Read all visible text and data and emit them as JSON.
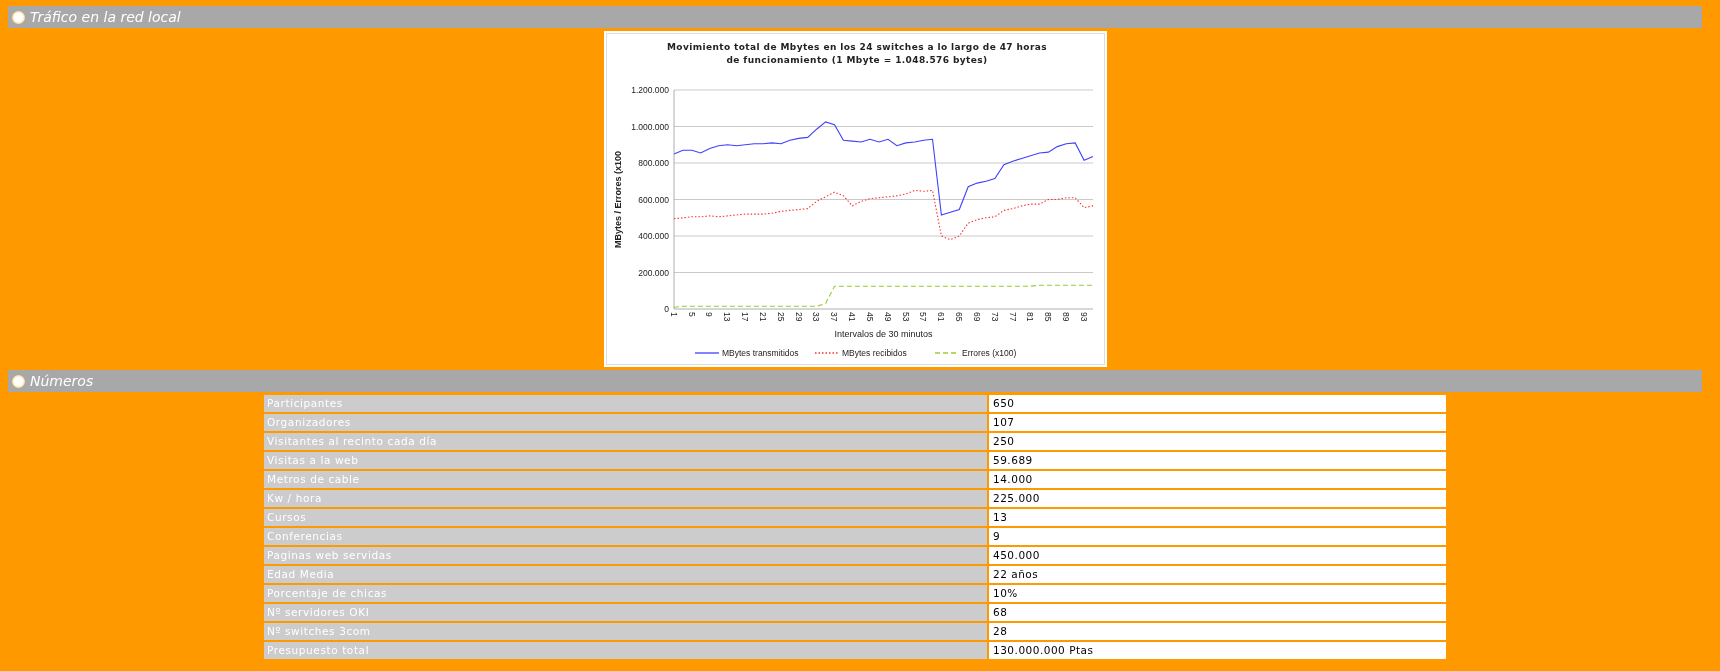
{
  "sections": [
    {
      "title": "Tráfico en la red local",
      "chart_data": {
        "type": "line",
        "title": "Movimiento total de Mbytes en los 24 switches a lo largo de 47 horas de funcionamiento (1 Mbyte = 1.048.576 bytes)",
        "xlabel": "Intervalos de 30 minutos",
        "ylabel": "MBytes / Errores (x100",
        "x": [
          1,
          3,
          5,
          7,
          9,
          11,
          13,
          15,
          17,
          19,
          21,
          23,
          25,
          27,
          29,
          31,
          33,
          35,
          37,
          39,
          41,
          43,
          45,
          47,
          49,
          51,
          53,
          55,
          57,
          59,
          61,
          63,
          65,
          67,
          69,
          71,
          73,
          75,
          77,
          79,
          81,
          83,
          85,
          87,
          89,
          91,
          93,
          95
        ],
        "series": [
          {
            "name": "MBytes transmitidos",
            "color": "#4040ff",
            "line_style": "solid",
            "values": [
              850000,
              870000,
              870000,
              855000,
              880000,
              895000,
              900000,
              895000,
              900000,
              905000,
              905000,
              910000,
              905000,
              925000,
              935000,
              940000,
              985000,
              1025000,
              1010000,
              925000,
              920000,
              915000,
              930000,
              915000,
              930000,
              895000,
              910000,
              915000,
              925000,
              930000,
              515000,
              530000,
              545000,
              670000,
              690000,
              700000,
              715000,
              790000,
              810000,
              825000,
              840000,
              855000,
              860000,
              890000,
              905000,
              910000,
              815000,
              835000
            ]
          },
          {
            "name": "MBytes recibidos",
            "color": "#ff3030",
            "line_style": "dotted",
            "values": [
              495000,
              500000,
              505000,
              505000,
              510000,
              505000,
              510000,
              515000,
              520000,
              520000,
              520000,
              525000,
              535000,
              540000,
              545000,
              550000,
              590000,
              615000,
              640000,
              620000,
              565000,
              590000,
              605000,
              610000,
              615000,
              620000,
              630000,
              650000,
              645000,
              650000,
              400000,
              380000,
              400000,
              470000,
              490000,
              500000,
              505000,
              540000,
              550000,
              565000,
              575000,
              575000,
              600000,
              600000,
              610000,
              610000,
              555000,
              565000
            ]
          },
          {
            "name": "Errores (x100)",
            "color": "#99cc33",
            "line_style": "dashed",
            "values": [
              10000,
              15000,
              15000,
              15000,
              15000,
              15000,
              15000,
              15000,
              15000,
              15000,
              15000,
              15000,
              15000,
              15000,
              15000,
              15000,
              15000,
              30000,
              125000,
              125000,
              125000,
              125000,
              125000,
              125000,
              125000,
              125000,
              125000,
              125000,
              125000,
              125000,
              125000,
              125000,
              125000,
              125000,
              125000,
              125000,
              125000,
              125000,
              125000,
              125000,
              125000,
              130000,
              130000,
              130000,
              130000,
              130000,
              130000,
              130000
            ]
          }
        ],
        "xlim": [
          1,
          95
        ],
        "ylim": [
          0,
          1200000
        ],
        "grid": true,
        "legend": "bottom",
        "xticks": [
          1,
          5,
          9,
          13,
          17,
          21,
          25,
          29,
          33,
          37,
          41,
          45,
          49,
          53,
          57,
          61,
          65,
          69,
          73,
          77,
          81,
          85,
          89,
          93
        ],
        "yticks": [
          {
            "value": 0,
            "label": "0"
          },
          {
            "value": 200000,
            "label": "200.000"
          },
          {
            "value": 400000,
            "label": "400.000"
          },
          {
            "value": 600000,
            "label": "600.000"
          },
          {
            "value": 800000,
            "label": "800.000"
          },
          {
            "value": 1000000,
            "label": "1.000.000"
          },
          {
            "value": 1200000,
            "label": "1.200.000"
          }
        ]
      }
    },
    {
      "title": "Números",
      "table": {
        "rows": [
          {
            "label": "Participantes",
            "value": "650"
          },
          {
            "label": "Organizadores",
            "value": "107"
          },
          {
            "label": "Visitantes al recinto cada día",
            "value": "250"
          },
          {
            "label": "Visitas a la web",
            "value": "59.689"
          },
          {
            "label": "Metros de cable",
            "value": "14.000"
          },
          {
            "label": "Kw / hora",
            "value": "225.000"
          },
          {
            "label": "Cursos",
            "value": "13"
          },
          {
            "label": "Conferencias",
            "value": "9"
          },
          {
            "label": "Paginas web servidas",
            "value": "450.000"
          },
          {
            "label": "Edad Media",
            "value": "22 años"
          },
          {
            "label": "Porcentaje de chicas",
            "value": "10%"
          },
          {
            "label": "Nº servidores OKI",
            "value": "68"
          },
          {
            "label": "Nº switches 3com",
            "value": "28"
          },
          {
            "label": "Presupuesto total",
            "value": "130.000.000 Ptas"
          }
        ]
      }
    }
  ]
}
